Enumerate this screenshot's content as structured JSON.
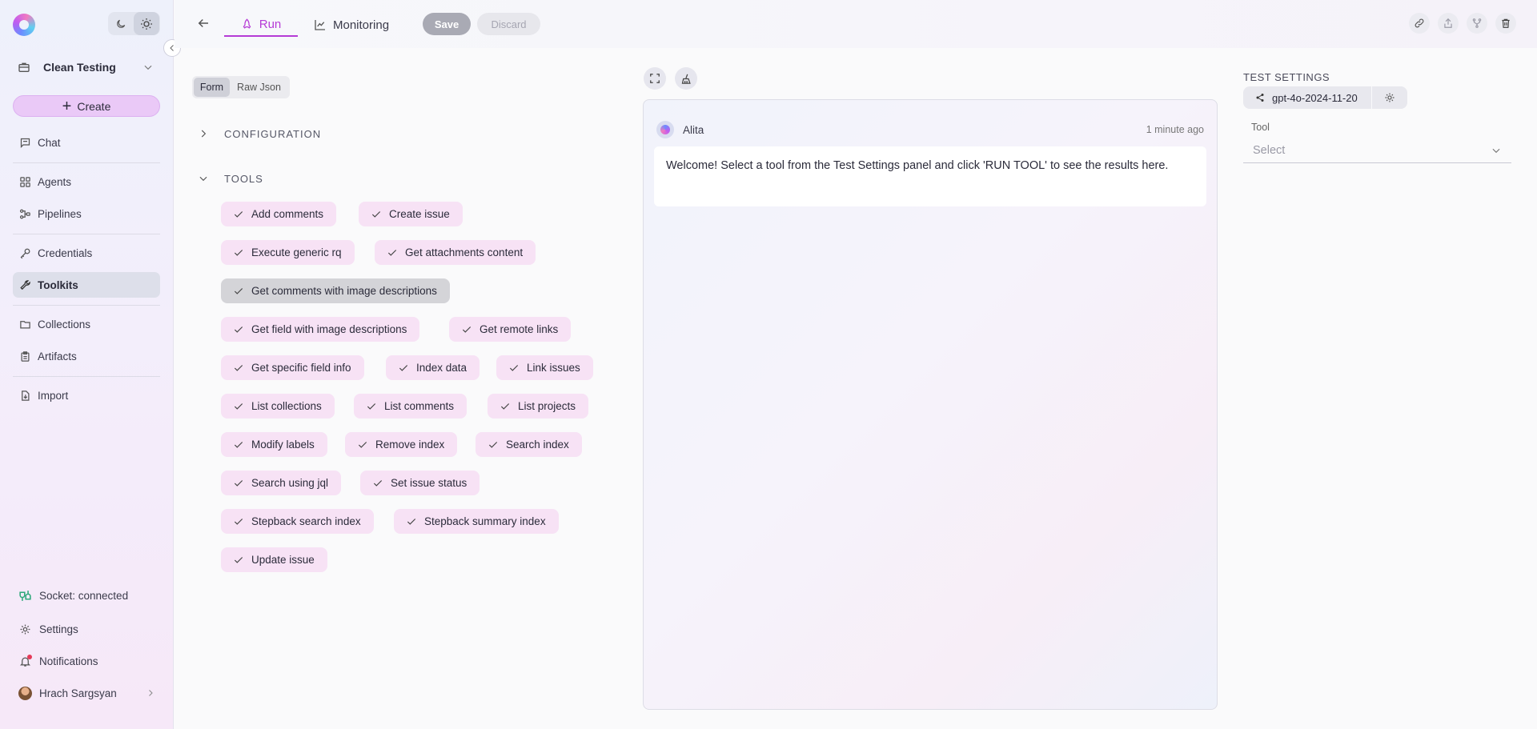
{
  "sidebar": {
    "project_name": "Clean Testing",
    "create_label": "Create",
    "nav": [
      {
        "label": "Chat",
        "icon": "chat-icon"
      },
      {
        "label": "Agents",
        "icon": "grid-icon"
      },
      {
        "label": "Pipelines",
        "icon": "pipeline-icon"
      },
      {
        "label": "Credentials",
        "icon": "key-icon"
      },
      {
        "label": "Toolkits",
        "icon": "wrench-icon",
        "active": true
      },
      {
        "label": "Collections",
        "icon": "folder-icon"
      },
      {
        "label": "Artifacts",
        "icon": "artifact-icon"
      },
      {
        "label": "Import",
        "icon": "import-icon"
      }
    ],
    "footer": {
      "socket": "Socket: connected",
      "settings": "Settings",
      "notifications": "Notifications",
      "user": "Hrach Sargsyan"
    }
  },
  "topbar": {
    "tabs": [
      {
        "label": "Run",
        "active": true
      },
      {
        "label": "Monitoring"
      }
    ],
    "save_label": "Save",
    "discard_label": "Discard",
    "actions": [
      "link-icon",
      "share-icon",
      "fork-icon",
      "trash-icon"
    ]
  },
  "editor": {
    "modes": [
      "Form",
      "Raw Json"
    ],
    "active_mode": "Form",
    "sections": {
      "configuration": "CONFIGURATION",
      "tools": "TOOLS"
    },
    "tools": [
      "Add comments",
      "Create issue",
      "Execute generic rq",
      "Get attachments content",
      "Get comments with image descriptions",
      "Get field with image descriptions",
      "Get remote links",
      "Get specific field info",
      "Index data",
      "Link issues",
      "List collections",
      "List comments",
      "List projects",
      "Modify labels",
      "Remove index",
      "Search index",
      "Search using jql",
      "Set issue status",
      "Stepback search index",
      "Stepback summary index",
      "Update issue"
    ],
    "selected_tool": "Get comments with image descriptions"
  },
  "chat": {
    "sender": "Alita",
    "time": "1 minute ago",
    "message": "Welcome! Select a tool from the Test Settings panel and click 'RUN TOOL' to see the results here."
  },
  "test_settings": {
    "title": "TEST SETTINGS",
    "model": "gpt-4o-2024-11-20",
    "tool_label": "Tool",
    "tool_placeholder": "Select"
  },
  "colors": {
    "accent": "#b53bd6",
    "chip_bg": "#f7e2f5",
    "create_bg": "#eac9f7",
    "socket_ok": "#2ea87a"
  }
}
